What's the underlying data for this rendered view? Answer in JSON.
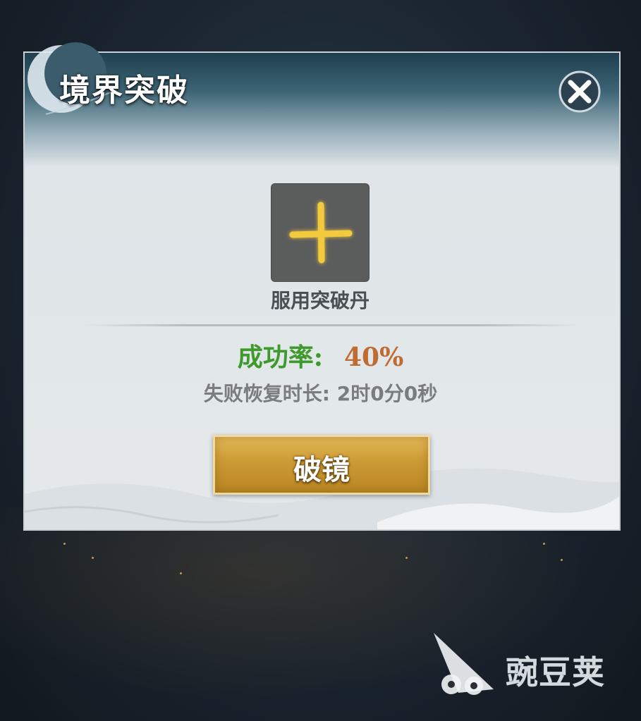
{
  "dialog": {
    "title": "境界突破",
    "item_slot_label": "服用突破丹",
    "success_rate_label": "成功率:",
    "success_rate_value": "40%",
    "recovery_text": "失败恢复时长: 2时0分0秒",
    "break_button_label": "破镜"
  },
  "icons": {
    "close": "close-icon",
    "add": "plus-icon",
    "moon": "crescent-moon-icon"
  },
  "watermark": {
    "text": "豌豆荚",
    "logo": "wandoujia-logo"
  },
  "colors": {
    "success_label": "#3f9a2d",
    "success_value": "#c06b32",
    "button_gold": "#cc9a33",
    "plus_gold": "#f3c93e"
  }
}
